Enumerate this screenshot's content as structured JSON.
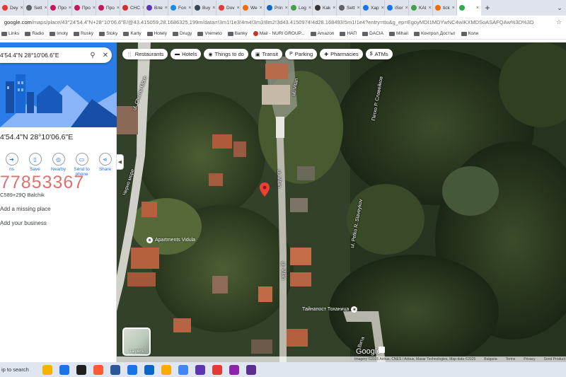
{
  "browser": {
    "tabs": [
      {
        "label": "Dey",
        "color": "#e53935"
      },
      {
        "label": "Sett",
        "color": "#5f6368"
      },
      {
        "label": "Про",
        "color": "#c2185b"
      },
      {
        "label": "Про",
        "color": "#c2185b"
      },
      {
        "label": "Про",
        "color": "#c2185b"
      },
      {
        "label": "CHC",
        "color": "#d32f2f"
      },
      {
        "label": "Вле",
        "color": "#5e35b1"
      },
      {
        "label": "Fon",
        "color": "#1e88e5"
      },
      {
        "label": "Buy",
        "color": "#37474f"
      },
      {
        "label": "Dov",
        "color": "#e53935"
      },
      {
        "label": "We",
        "color": "#ef6c00"
      },
      {
        "label": "Prin",
        "color": "#1565c0"
      },
      {
        "label": "Log",
        "color": "#43a047"
      },
      {
        "label": "Kak",
        "color": "#333333"
      },
      {
        "label": "Sett",
        "color": "#5f6368"
      },
      {
        "label": "Хар",
        "color": "#1a73e8"
      },
      {
        "label": "iSor",
        "color": "#1a73e8"
      },
      {
        "label": "KAt",
        "color": "#43a047"
      },
      {
        "label": "tick",
        "color": "#ef6c00"
      },
      {
        "label": "",
        "color": "#34a853"
      }
    ],
    "new_tab_label": "+",
    "url_host": "google.com",
    "url_path": "/maps/place/43°24'54.4\"N+28°10'06.6\"E/@43.415059,28.1686325,199m/data=!3m1!1e3!4m4!3m3!8m2!3d43.4150974!4d28.168493!5m1!1e4?entry=ttu&g_ep=EgoyMDI1MDYwNC4wIKXMDSoASAFQAw%3D%3D",
    "bookmarks": [
      {
        "label": "Links",
        "kind": "folder"
      },
      {
        "label": "Radio",
        "kind": "folder"
      },
      {
        "label": "Imoty",
        "kind": "folder"
      },
      {
        "label": "Rusky",
        "kind": "folder"
      },
      {
        "label": "Stoky",
        "kind": "folder"
      },
      {
        "label": "Karty",
        "kind": "folder"
      },
      {
        "label": "Hotely",
        "kind": "folder"
      },
      {
        "label": "Drugy",
        "kind": "folder"
      },
      {
        "label": "Vremeto",
        "kind": "folder"
      },
      {
        "label": "Banky",
        "kind": "folder"
      },
      {
        "label": "Mail - NURI GROUP...",
        "kind": "site"
      },
      {
        "label": "Amazon",
        "kind": "folder"
      },
      {
        "label": "НАП",
        "kind": "folder"
      },
      {
        "label": "DACIA",
        "kind": "folder"
      },
      {
        "label": "Mihail",
        "kind": "folder"
      },
      {
        "label": "Контрол Достъп",
        "kind": "folder"
      },
      {
        "label": "Коли",
        "kind": "folder"
      }
    ]
  },
  "panel": {
    "search_value": "4'54.4\"N 28°10'06.6\"E",
    "title": "4'54.4\"N 28°10'06.6\"E",
    "actions": [
      {
        "label": "ns",
        "icon": "directions-icon"
      },
      {
        "label": "Save",
        "icon": "bookmark-icon"
      },
      {
        "label": "Nearby",
        "icon": "nearby-icon"
      },
      {
        "label": "Send to phone",
        "icon": "phone-icon"
      },
      {
        "label": "Share",
        "icon": "share-icon"
      }
    ],
    "overlay_number": "77853367",
    "plus_code": "C589+29Q Balchik",
    "add_place": "Add a missing place",
    "add_business": "Add your business"
  },
  "map": {
    "chips": [
      {
        "label": "Restaurants",
        "icon": "fork-icon"
      },
      {
        "label": "Hotels",
        "icon": "bed-icon"
      },
      {
        "label": "Things to do",
        "icon": "camera-icon"
      },
      {
        "label": "Transit",
        "icon": "bus-icon"
      },
      {
        "label": "Parking",
        "icon": "parking-icon"
      },
      {
        "label": "Pharmacies",
        "icon": "pharmacy-icon"
      },
      {
        "label": "ATMs",
        "icon": "atm-icon"
      }
    ],
    "streets": {
      "left_vertical": "ul. Cherno More",
      "left_vertical_2": "Черно море",
      "center_top": "ul. Vitan",
      "center_mid": "ul. Vitan",
      "center_bottom": "ul. Vitan",
      "right_top": "Петко Р. Славейков",
      "right_mid": "ul. Petko R. Slaveykov",
      "bottom_right": "Вита"
    },
    "poi_apartments": "Apartments Vidula",
    "poi_vila": "Тайнапост Тоханица",
    "layers_label": "Layers",
    "google_logo": "Google",
    "attribution": "Imagery ©2025 Airbus, CNES / Airbus, Maxar Technologies, Map data ©2025",
    "attribution_links": [
      "Bulgaria",
      "Terms",
      "Privacy",
      "Send Product Feedback"
    ]
  },
  "taskbar": {
    "search_label": "ip to search",
    "apps": [
      "#f4b400",
      "#1a73e8",
      "#1e1e1e",
      "#ff5a36",
      "#2b579a",
      "#1a73e8",
      "#0a66c2",
      "#f9ab00",
      "#4285f4",
      "#5e35b1",
      "#e53935",
      "#8e24aa",
      "#5c2d91"
    ]
  }
}
